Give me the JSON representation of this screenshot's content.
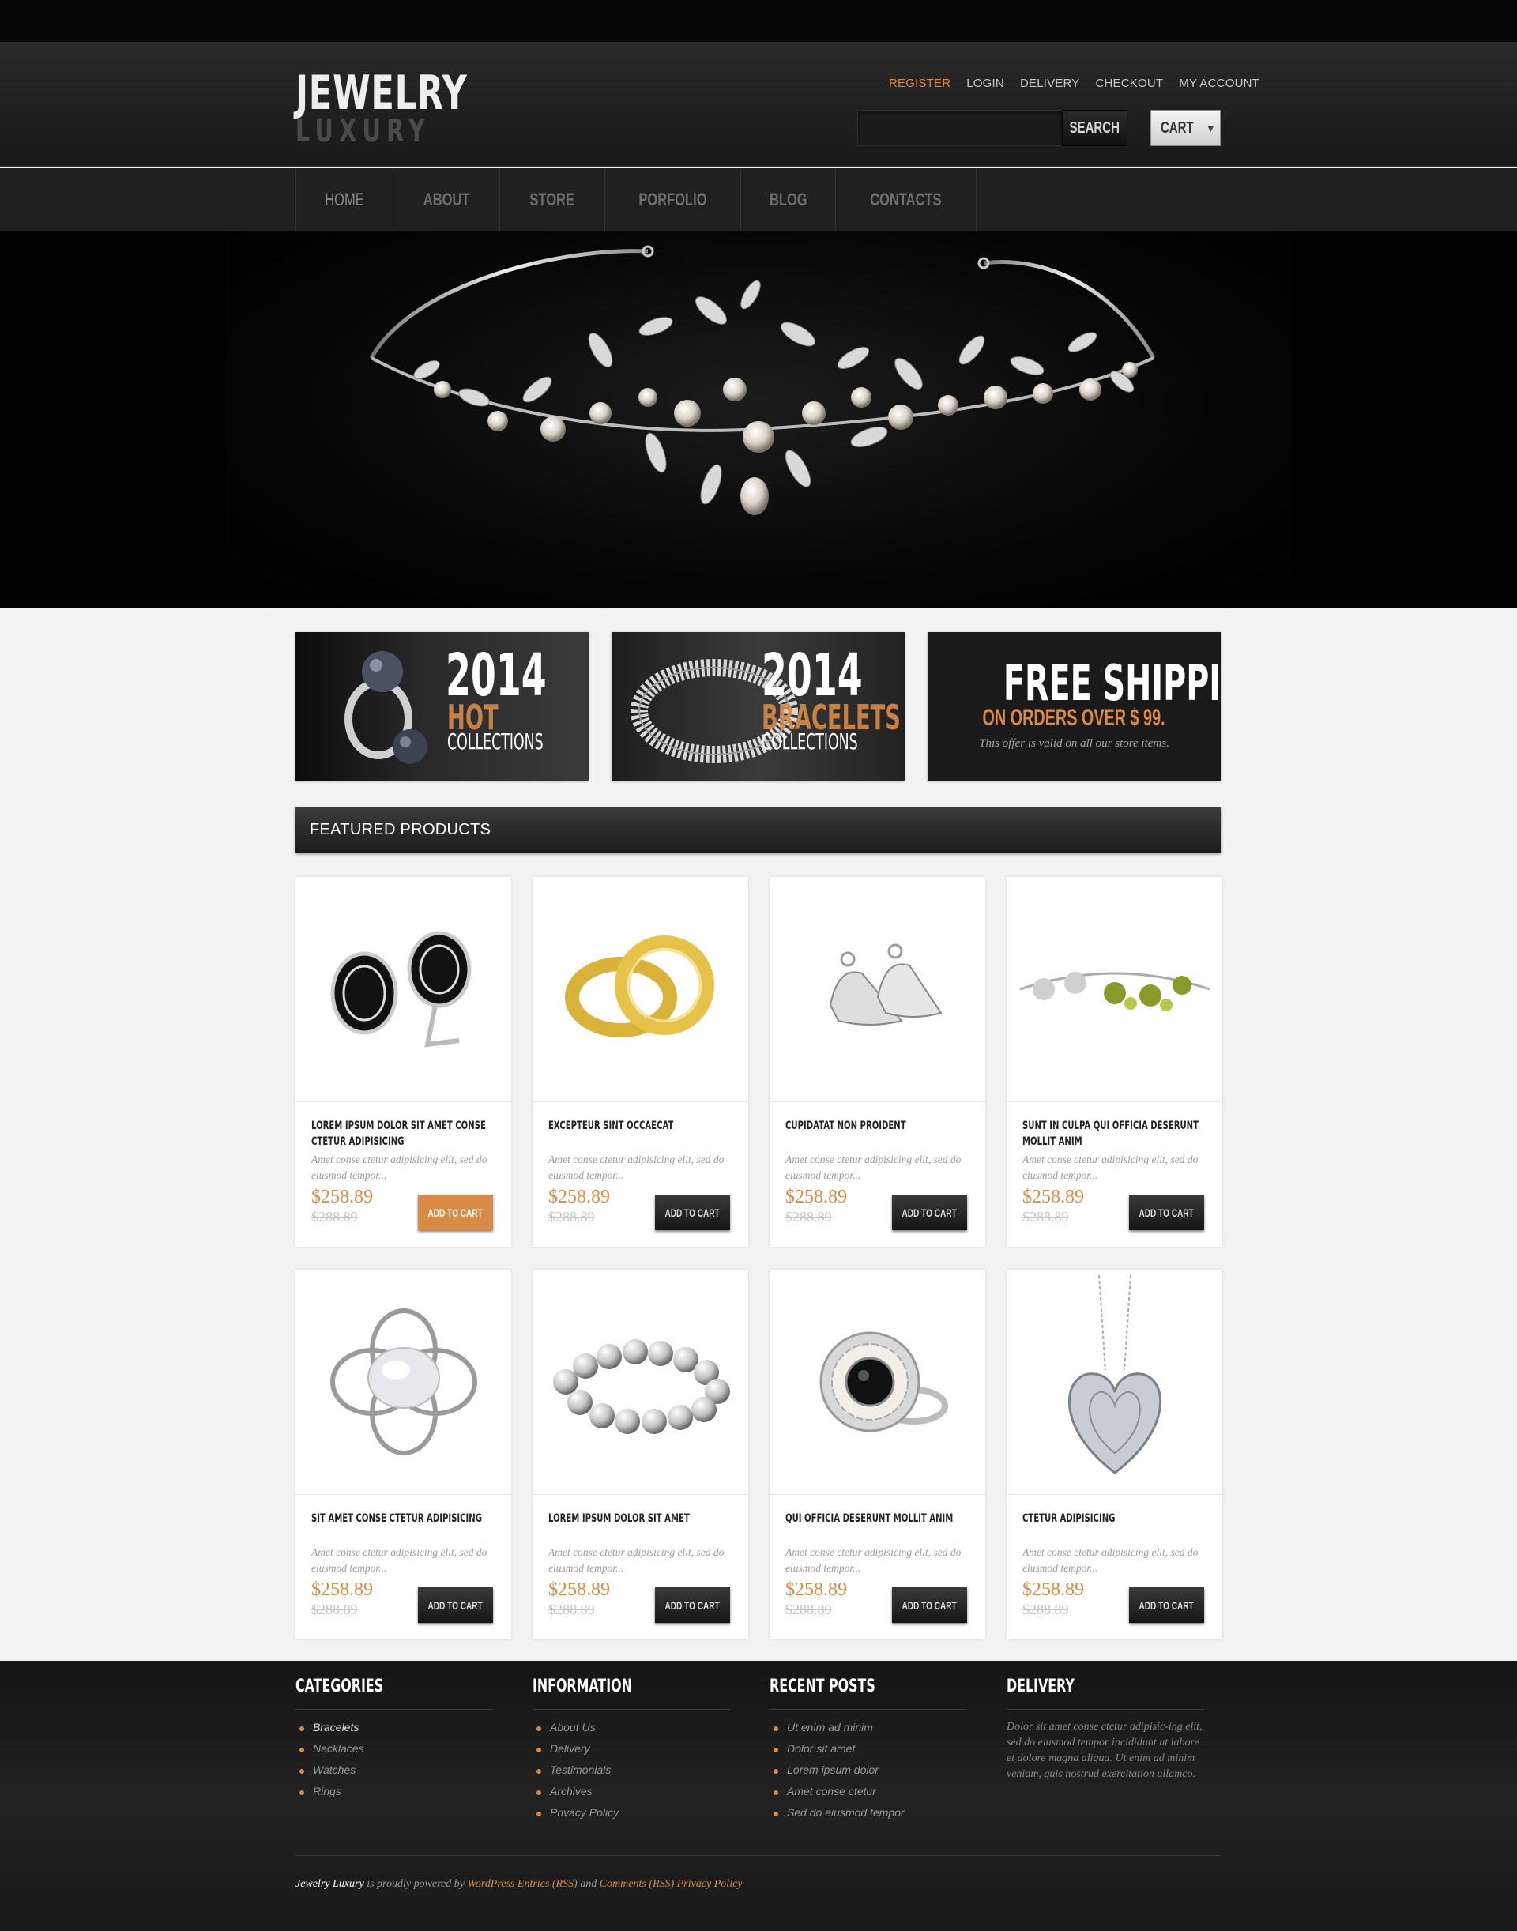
{
  "brand": {
    "name": "JEWELRY",
    "tagline": "LUXURY"
  },
  "top_links": [
    {
      "label": "REGISTER"
    },
    {
      "label": "LOGIN"
    },
    {
      "label": "DELIVERY"
    },
    {
      "label": "CHECKOUT"
    },
    {
      "label": "MY ACCOUNT"
    }
  ],
  "search": {
    "placeholder": "",
    "button_label": "SEARCH"
  },
  "cart": {
    "label": "CART"
  },
  "nav": [
    {
      "label": "HOME"
    },
    {
      "label": "ABOUT"
    },
    {
      "label": "STORE"
    },
    {
      "label": "PORFOLIO"
    },
    {
      "label": "BLOG"
    },
    {
      "label": "CONTACTS"
    }
  ],
  "promos": [
    {
      "year": "2014",
      "accent": "HOT",
      "line": "COLLECTIONS"
    },
    {
      "year": "2014",
      "accent": "BRACELETS",
      "line": "COLLECTIONS"
    },
    {
      "title": "FREE SHIPPING",
      "subtitle": "ON ORDERS OVER $ 99.",
      "note": "This offer is valid on all our  store items."
    }
  ],
  "featured": {
    "title": "FEATURED PRODUCTS"
  },
  "products": [
    {
      "title": "LOREM IPSUM DOLOR SIT AMET CONSE CTETUR ADIPISICING",
      "desc": "Amet conse ctetur adipisicing elit, sed do eiusmod tempor...",
      "price": "$258.89",
      "old_price": "$288.89",
      "button": "ADD TO CART"
    },
    {
      "title": "EXCEPTEUR SINT OCCAECAT",
      "desc": "Amet conse ctetur adipisicing elit, sed do eiusmod tempor...",
      "price": "$258.89",
      "old_price": "$288.89",
      "button": "ADD TO CART"
    },
    {
      "title": "CUPIDATAT NON PROIDENT",
      "desc": "Amet conse ctetur adipisicing elit, sed do eiusmod tempor...",
      "price": "$258.89",
      "old_price": "$288.89",
      "button": "ADD TO CART"
    },
    {
      "title": "SUNT IN CULPA QUI OFFICIA DESERUNT MOLLIT ANIM",
      "desc": "Amet conse ctetur adipisicing elit, sed do eiusmod tempor...",
      "price": "$258.89",
      "old_price": "$288.89",
      "button": "ADD TO CART"
    },
    {
      "title": "SIT AMET CONSE CTETUR ADIPISICING",
      "desc": "Amet conse ctetur adipisicing elit, sed do eiusmod tempor...",
      "price": "$258.89",
      "old_price": "$288.89",
      "button": "ADD TO CART"
    },
    {
      "title": "LOREM IPSUM DOLOR SIT AMET",
      "desc": "Amet conse ctetur adipisicing elit, sed do eiusmod tempor...",
      "price": "$258.89",
      "old_price": "$288.89",
      "button": "ADD TO CART"
    },
    {
      "title": "QUI OFFICIA DESERUNT MOLLIT ANIM",
      "desc": "Amet conse ctetur adipisicing elit, sed do eiusmod tempor...",
      "price": "$258.89",
      "old_price": "$288.89",
      "button": "ADD TO CART"
    },
    {
      "title": "CTETUR ADIPISICING",
      "desc": "Amet conse ctetur adipisicing elit, sed do eiusmod tempor...",
      "price": "$258.89",
      "old_price": "$288.89",
      "button": "ADD TO CART"
    }
  ],
  "footer": {
    "categories": {
      "title": "CATEGORIES",
      "items": [
        "Bracelets",
        "Necklaces",
        "Watches",
        "Rings"
      ]
    },
    "information": {
      "title": "INFORMATION",
      "items": [
        "About Us",
        "Delivery",
        "Testimonials",
        "Archives",
        "Privacy Policy"
      ]
    },
    "recent_posts": {
      "title": "RECENT POSTS",
      "items": [
        "Ut enim ad minim",
        "Dolor sit amet",
        "Lorem ipsum dolor",
        "Amet conse ctetur",
        "Sed do eiusmod tempor"
      ]
    },
    "delivery": {
      "title": "DELIVERY",
      "text": "Dolor sit amet conse ctetur adipisic-ing elit, sed do eiusmod tempor incididunt ut labore et dolore magna aliqua. Ut enim ad minim veniam, quis nostrud exercitation ullamco."
    },
    "copyright": {
      "brand": "Jewelry Luxury",
      "powered": " is proudly powered by ",
      "wp": "WordPress",
      "entries": " Entries (RSS)",
      "and": " and ",
      "comments": "Comments (RSS)",
      "privacy": " Privacy Policy"
    }
  },
  "colors": {
    "accent": "#d98b46",
    "dark": "#1c1c1c",
    "background": "#f2f2f2"
  }
}
